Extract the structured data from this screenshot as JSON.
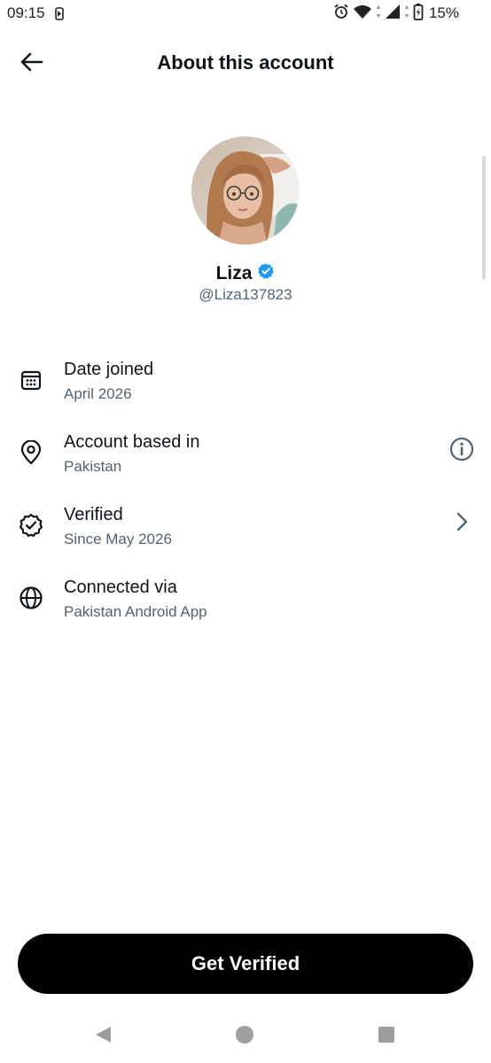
{
  "status_bar": {
    "time": "09:15",
    "battery": "15%"
  },
  "header": {
    "title": "About this account"
  },
  "profile": {
    "name": "Liza",
    "handle": "@Liza137823",
    "verified_color": "#1d9bf0"
  },
  "info_items": [
    {
      "title": "Date joined",
      "value": "April 2026",
      "icon": "calendar-icon"
    },
    {
      "title": "Account based in",
      "value": "Pakistan",
      "icon": "location-pin-icon",
      "trailing": "info-icon"
    },
    {
      "title": "Verified",
      "value": "Since May 2026",
      "icon": "verified-badge-icon",
      "trailing": "chevron-right-icon"
    },
    {
      "title": "Connected via",
      "value": "Pakistan Android App",
      "icon": "globe-icon"
    }
  ],
  "cta": {
    "label": "Get Verified"
  },
  "colors": {
    "text_primary": "#0f1419",
    "text_secondary": "#536471",
    "button_bg": "#000000"
  }
}
